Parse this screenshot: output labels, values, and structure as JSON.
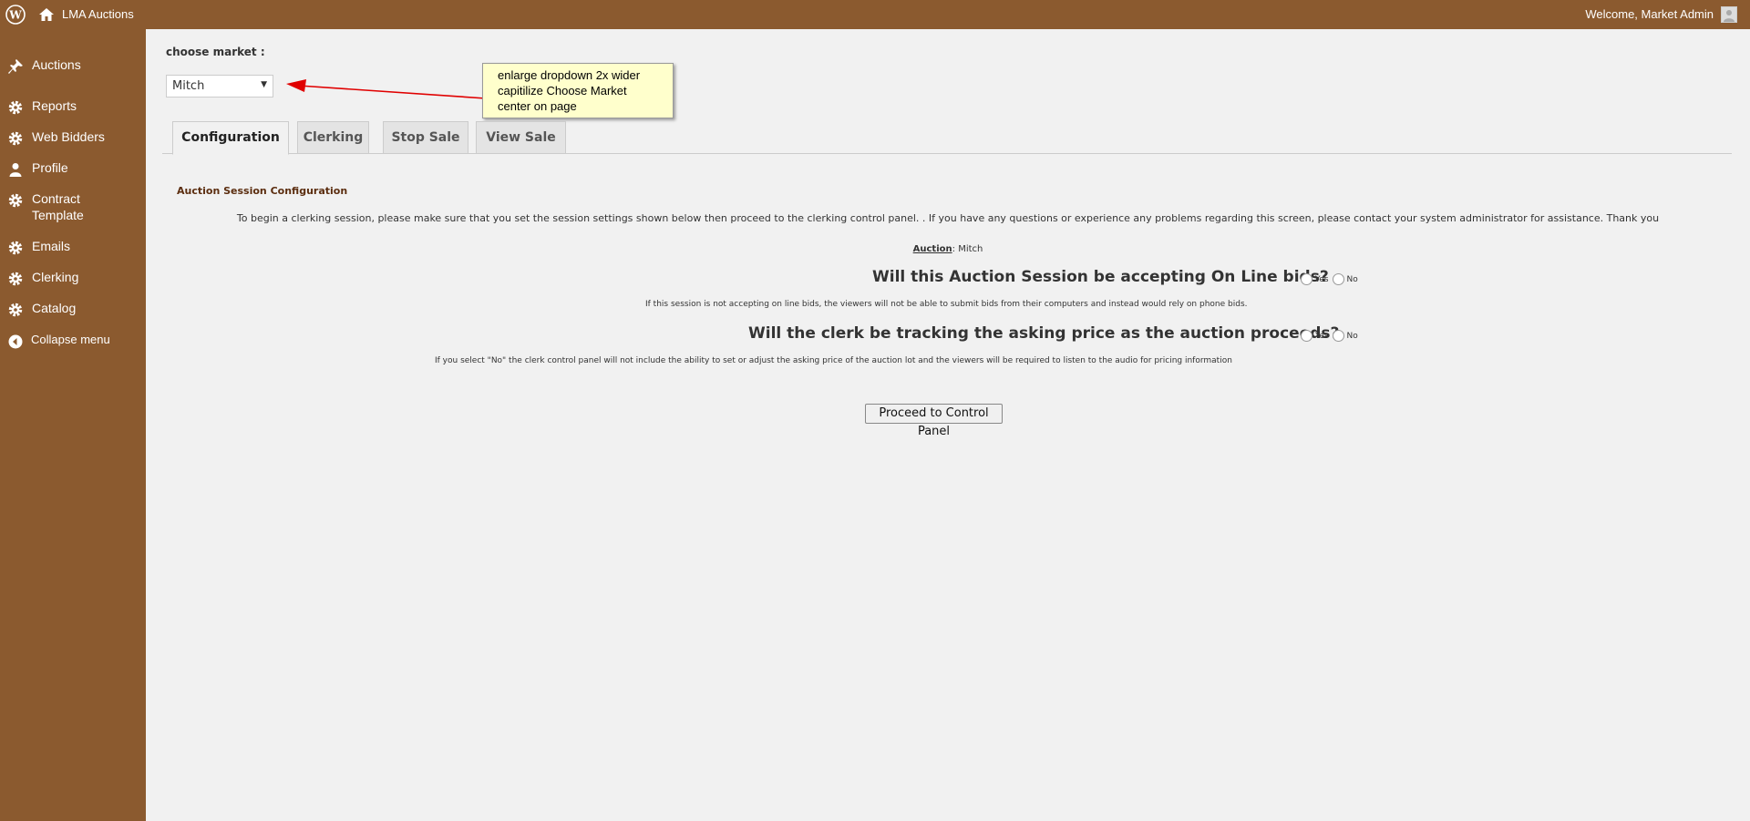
{
  "adminbar": {
    "site_name": "LMA Auctions",
    "welcome": "Welcome, Market Admin"
  },
  "sidebar": {
    "items": [
      {
        "label": "Auctions",
        "icon": "pin-icon"
      },
      {
        "label": "Reports",
        "icon": "gear-icon"
      },
      {
        "label": "Web Bidders",
        "icon": "gear-icon"
      },
      {
        "label": "Profile",
        "icon": "user-icon"
      },
      {
        "label": "Contract Template",
        "icon": "gear-icon"
      },
      {
        "label": "Emails",
        "icon": "gear-icon"
      },
      {
        "label": "Clerking",
        "icon": "gear-icon"
      },
      {
        "label": "Catalog",
        "icon": "gear-icon"
      }
    ],
    "collapse_label": "Collapse menu"
  },
  "market": {
    "label": "choose market :",
    "selected": "Mitch"
  },
  "annotation": {
    "lines": [
      "enlarge dropdown 2x wider",
      "capitilize Choose Market",
      "center on page"
    ]
  },
  "tabs": [
    {
      "label": "Configuration",
      "active": true
    },
    {
      "label": "Clerking",
      "active": false
    },
    {
      "label": "Stop Sale",
      "active": false
    },
    {
      "label": "View Sale",
      "active": false
    }
  ],
  "config": {
    "section_title": "Auction Session Configuration",
    "intro": "To begin a clerking session, please make sure that you set the session settings shown below then proceed to the clerking control panel. . If you have any questions or experience any problems regarding this screen, please contact your system administrator for assistance. Thank you",
    "auction_label": "Auction",
    "auction_value": "Mitch",
    "q1": "Will this Auction Session be accepting On Line bids?",
    "q1_hint": "If this session is not accepting on line bids, the viewers will not be able to submit bids from their computers and instead would rely on phone bids.",
    "q2": "Will the clerk be tracking the asking price as the auction proceeds?",
    "q2_hint": "If you select \"No\" the clerk control panel will not include the ability to set or adjust the asking price of the auction lot and the viewers will be required to listen to the audio for pricing information",
    "yes": "Yes",
    "no": "No",
    "proceed": "Proceed to Control Panel"
  },
  "colors": {
    "brand": "#8b5a2f",
    "annotation_bg": "#ffffcc",
    "annotation_arrow": "#e00000"
  }
}
